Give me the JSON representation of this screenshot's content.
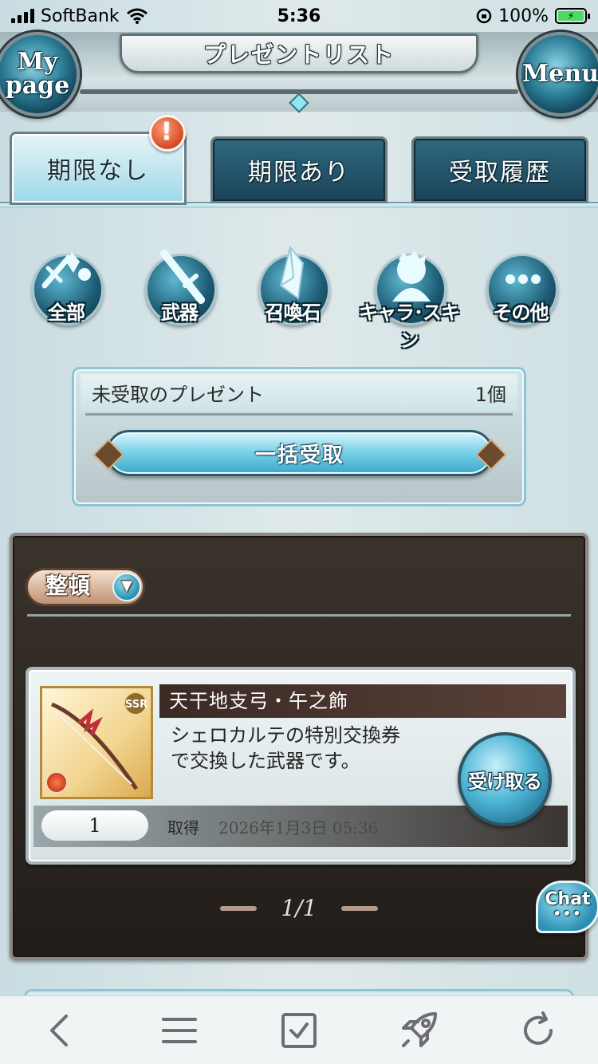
{
  "status_bar": {
    "carrier": "SoftBank",
    "time": "5:36",
    "battery": "100%"
  },
  "header": {
    "left_button": "My page",
    "left_button_line1": "My",
    "left_button_line2": "page",
    "title": "プレゼントリスト",
    "right_button": "Menu"
  },
  "tabs": [
    {
      "label": "期限なし",
      "active": true,
      "badge": "!"
    },
    {
      "label": "期限あり",
      "active": false
    },
    {
      "label": "受取履歴",
      "active": false
    }
  ],
  "categories": [
    {
      "label": "全部",
      "icon": "all-items-icon"
    },
    {
      "label": "武器",
      "icon": "sword-icon"
    },
    {
      "label": "召喚石",
      "icon": "crystal-icon"
    },
    {
      "label": "キャラ･スキン",
      "icon": "character-silhouette-icon"
    },
    {
      "label": "その他",
      "icon": "more-dots-icon"
    }
  ],
  "unclaimed": {
    "label": "未受取のプレゼント",
    "count": "1個",
    "bulk_button": "一括受取"
  },
  "list": {
    "sort_label": "整頓",
    "items": [
      {
        "name": "天干地支弓・午之飾",
        "rarity": "SSR",
        "desc_line1": "シェロカルテの特別交換券",
        "desc_line2": "で交換した武器です。",
        "quantity": "1",
        "acquired_label": "取得",
        "acquired_date": "2026年1月3日 05:36",
        "receive_button": "受け取る"
      }
    ],
    "page": "1/1"
  },
  "chat_button": "Chat",
  "chat_dots": "•••",
  "toolbar": {
    "icons": [
      "back-icon",
      "menu-icon",
      "checkbox-icon",
      "rocket-icon",
      "reload-icon"
    ]
  },
  "colors": {
    "accent_blue": "#3aa8c8",
    "tab_dark": "#1c4357",
    "panel_dark": "#221d19",
    "badge_red": "#d24a25"
  }
}
